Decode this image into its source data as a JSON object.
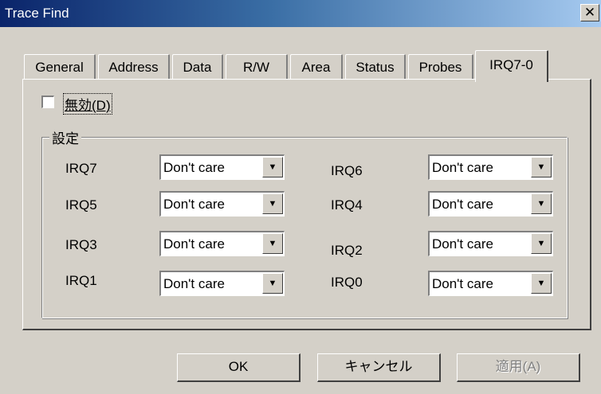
{
  "window": {
    "title": "Trace Find",
    "close_icon": "close-icon"
  },
  "tabs": [
    {
      "label": "General"
    },
    {
      "label": "Address"
    },
    {
      "label": "Data"
    },
    {
      "label": "R/W"
    },
    {
      "label": "Area"
    },
    {
      "label": "Status"
    },
    {
      "label": "Probes"
    },
    {
      "label": "IRQ7-0",
      "active": true
    }
  ],
  "disable": {
    "label": "無効(D)",
    "checked": false
  },
  "settings": {
    "group_label": "設定",
    "irqs": [
      {
        "label": "IRQ7",
        "value": "Don't care"
      },
      {
        "label": "IRQ6",
        "value": "Don't care"
      },
      {
        "label": "IRQ5",
        "value": "Don't care"
      },
      {
        "label": "IRQ4",
        "value": "Don't care"
      },
      {
        "label": "IRQ3",
        "value": "Don't care"
      },
      {
        "label": "IRQ2",
        "value": "Don't care"
      },
      {
        "label": "IRQ1",
        "value": "Don't care"
      },
      {
        "label": "IRQ0",
        "value": "Don't care"
      }
    ]
  },
  "buttons": {
    "ok": "OK",
    "cancel": "キャンセル",
    "apply": "適用(A)",
    "apply_enabled": false
  }
}
